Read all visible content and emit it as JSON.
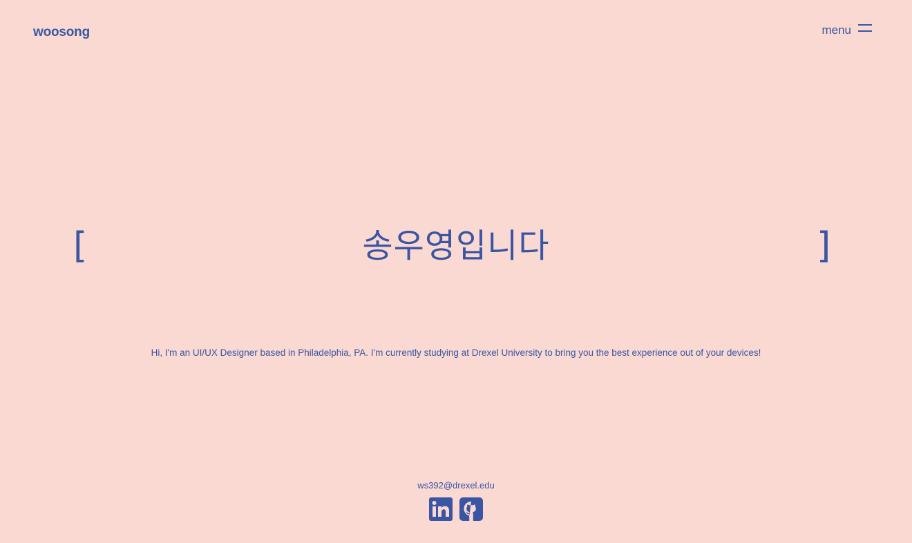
{
  "header": {
    "logo": "woosong",
    "menu_label": "menu",
    "menu_icon": "hamburger-menu-icon"
  },
  "hero": {
    "bracket_left": "[",
    "title": "송우영입니다",
    "bracket_right": "]"
  },
  "intro": {
    "text": "Hi, I'm an UI/UX Designer based in Philadelphia, PA. I'm currently studying at Drexel University to bring you the best experience out of your devices!"
  },
  "footer": {
    "email": "ws392@drexel.edu",
    "socials": [
      {
        "icon": "linkedin-icon"
      },
      {
        "icon": "github-icon"
      }
    ]
  },
  "colors": {
    "background": "#f9d9d1",
    "accent": "#3a55a4"
  }
}
